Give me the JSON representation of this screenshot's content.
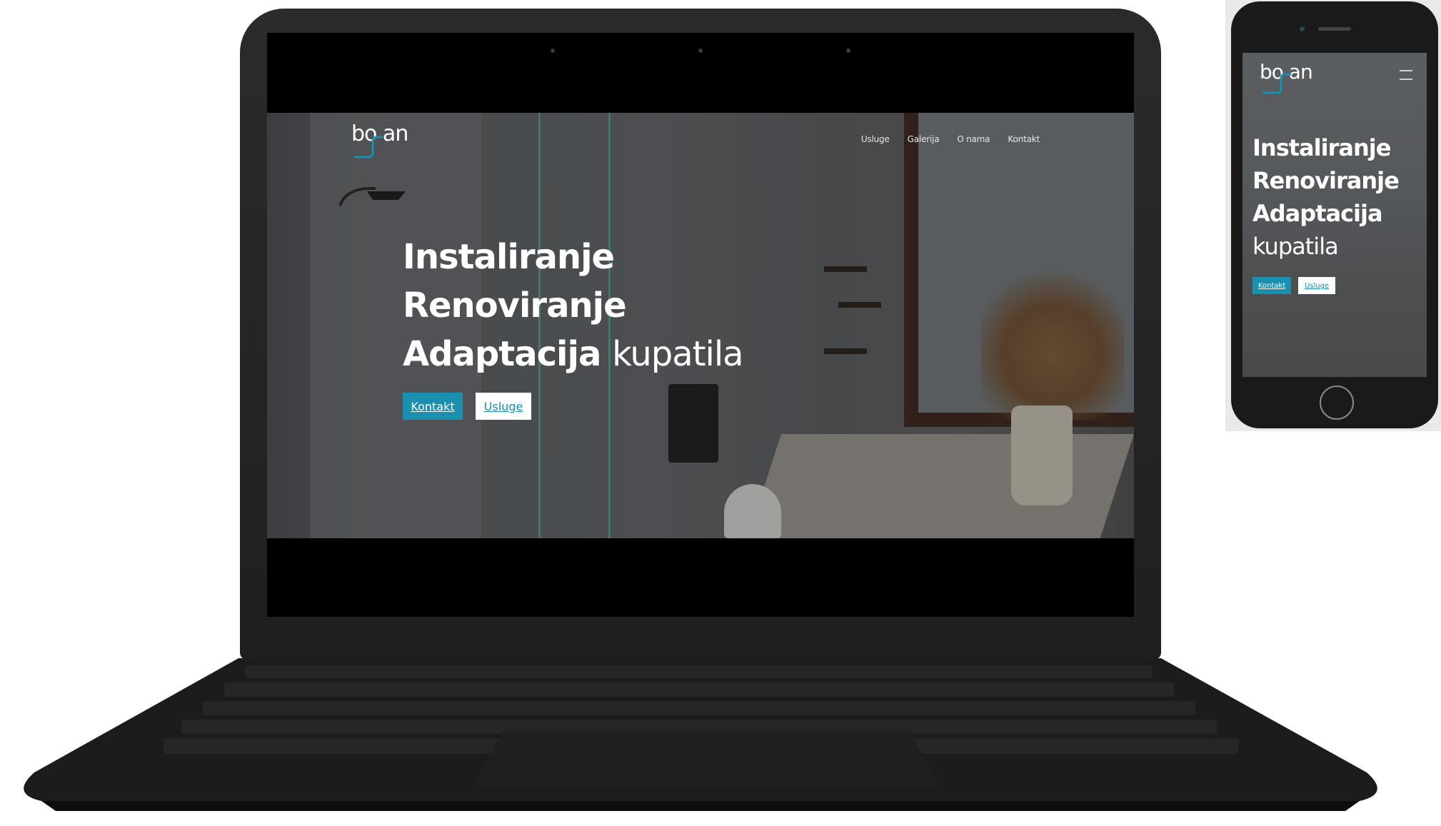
{
  "brand": {
    "logo_text": "bo an",
    "accent_color": "#1a8fae"
  },
  "desktop": {
    "nav": [
      {
        "label": "Usluge"
      },
      {
        "label": "Galerija"
      },
      {
        "label": "O nama"
      },
      {
        "label": "Kontakt"
      }
    ],
    "headline": {
      "line1": "Instaliranje",
      "line2": "Renoviranje",
      "line3_bold": "Adaptacija",
      "line3_light": "kupatila"
    },
    "buttons": {
      "primary": "Kontakt",
      "secondary": "Usluge"
    }
  },
  "mobile": {
    "headline": {
      "line1": "Instaliranje",
      "line2": "Renoviranje",
      "line3": "Adaptacija",
      "line4": "kupatila"
    },
    "buttons": {
      "primary": "Kontakt",
      "secondary": "Usluge"
    },
    "menu_icon": "hamburger-icon"
  }
}
